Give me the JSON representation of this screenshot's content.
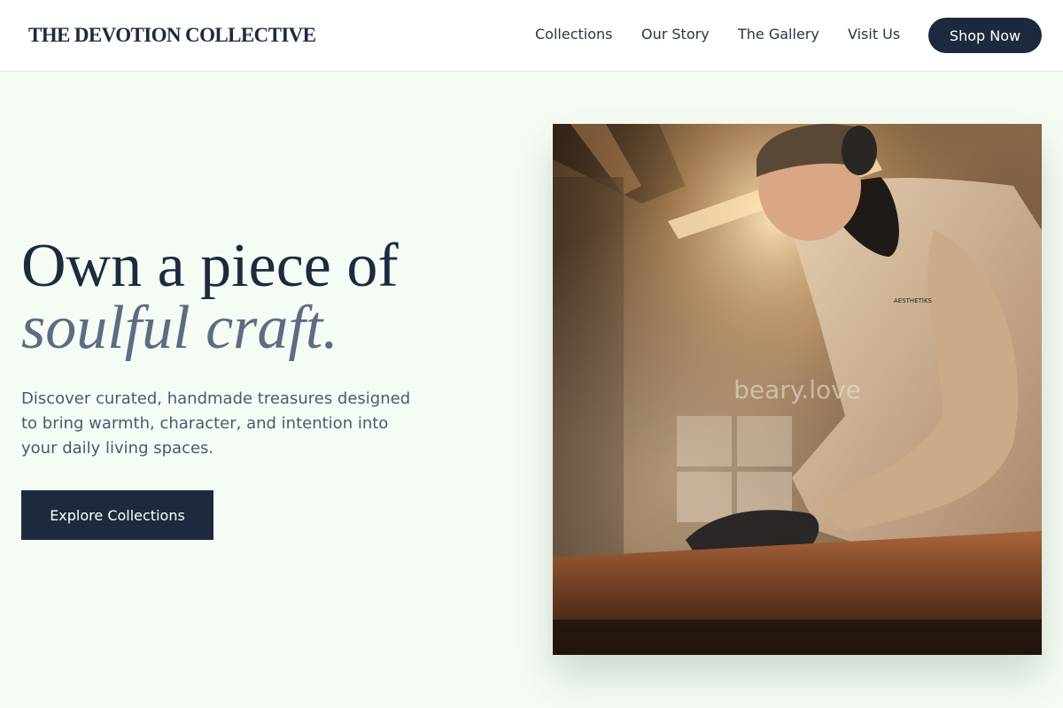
{
  "header": {
    "brand": "THE DEVOTION COLLECTIVE",
    "nav": [
      {
        "label": "Collections"
      },
      {
        "label": "Our Story"
      },
      {
        "label": "The Gallery"
      },
      {
        "label": "Visit Us"
      }
    ],
    "cta_label": "Shop Now"
  },
  "hero": {
    "title_line1": "Own a piece of",
    "title_line2": "soulful craft.",
    "description": "Discover curated, handmade treasures designed to bring warmth, character, and intention into your daily living spaces.",
    "cta_label": "Explore Collections",
    "image": {
      "watermark": "beary.love",
      "shirt_print": "AESTHETIKS"
    }
  },
  "colors": {
    "background": "#f5fcf4",
    "header_bg": "#ffffff",
    "primary": "#1d2a3e",
    "accent_italic": "#5f6b83",
    "body_text": "#4d5870"
  }
}
